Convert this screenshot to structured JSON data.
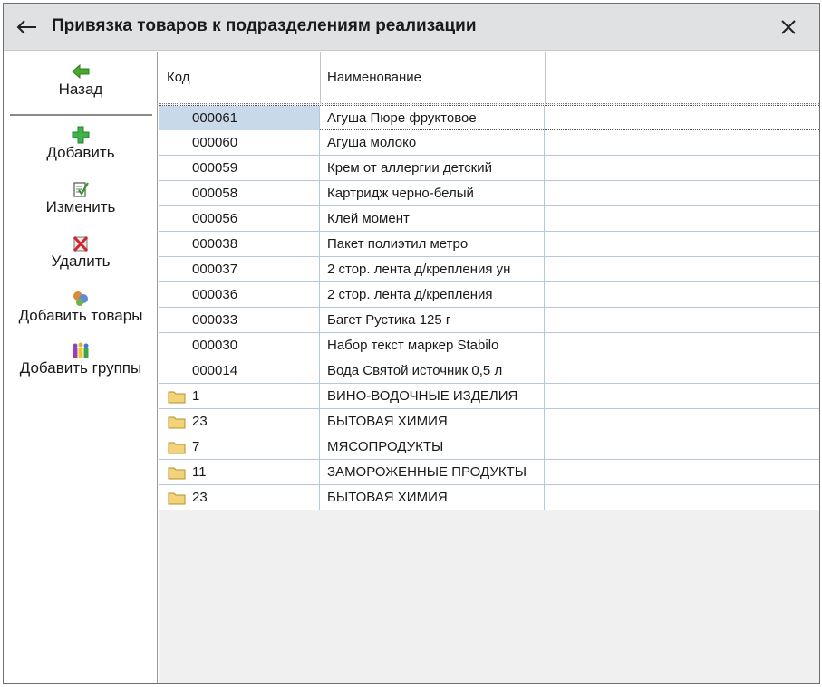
{
  "window": {
    "title": "Привязка товаров к подразделениям реализации",
    "back_icon": "back-arrow-icon",
    "close_icon": "close-icon"
  },
  "sidebar": {
    "items": [
      {
        "label": "Назад",
        "icon": "green-arrow-left-icon"
      },
      {
        "label": "Добавить",
        "icon": "green-plus-icon"
      },
      {
        "label": "Изменить",
        "icon": "edit-note-icon"
      },
      {
        "label": "Удалить",
        "icon": "delete-red-x-icon"
      },
      {
        "label": "Добавить товары",
        "icon": "add-goods-icon"
      },
      {
        "label": "Добавить группы",
        "icon": "add-groups-icon"
      }
    ]
  },
  "grid": {
    "columns": [
      "Код",
      "Наименование",
      ""
    ],
    "rows": [
      {
        "code": "000061",
        "name": "Агуша Пюре фруктовое",
        "folder": false,
        "selected": true
      },
      {
        "code": "000060",
        "name": "Агуша молоко",
        "folder": false
      },
      {
        "code": "000059",
        "name": "Крем от аллергии детский",
        "folder": false
      },
      {
        "code": "000058",
        "name": "Картридж черно-белый",
        "folder": false
      },
      {
        "code": "000056",
        "name": "Клей момент",
        "folder": false
      },
      {
        "code": "000038",
        "name": "Пакет полиэтил метро",
        "folder": false
      },
      {
        "code": "000037",
        "name": "2 стор. лента д/крепления ун",
        "folder": false
      },
      {
        "code": "000036",
        "name": "2 стор. лента д/крепления",
        "folder": false
      },
      {
        "code": "000033",
        "name": "Багет Рустика 125 г",
        "folder": false
      },
      {
        "code": "000030",
        "name": "Набор текст маркер Stabilo",
        "folder": false
      },
      {
        "code": "000014",
        "name": "Вода Святой источник 0,5 л",
        "folder": false
      },
      {
        "code": "1",
        "name": "ВИНО-ВОДОЧНЫЕ ИЗДЕЛИЯ",
        "folder": true
      },
      {
        "code": "23",
        "name": "БЫТОВАЯ ХИМИЯ",
        "folder": true
      },
      {
        "code": "7",
        "name": "МЯСОПРОДУКТЫ",
        "folder": true
      },
      {
        "code": "11",
        "name": "ЗАМОРОЖЕННЫЕ ПРОДУКТЫ",
        "folder": true
      },
      {
        "code": "23",
        "name": "БЫТОВАЯ ХИМИЯ",
        "folder": true
      }
    ]
  },
  "colors": {
    "titlebar_bg": "#dfe1e2",
    "grid_line": "#b6c6dc",
    "selected_cell": "#c8d9ea",
    "folder": "#f3d37a"
  }
}
